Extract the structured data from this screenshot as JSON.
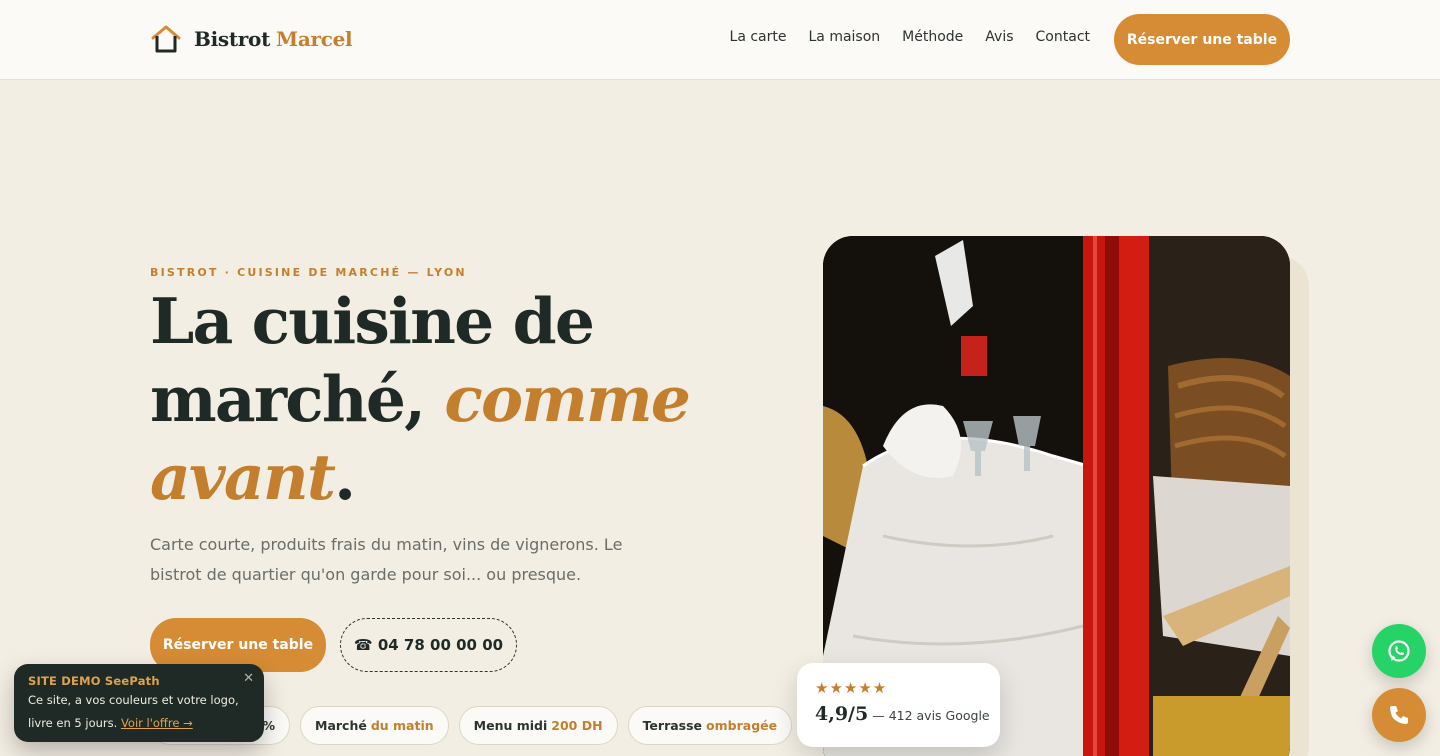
{
  "header": {
    "brand_first": "Bistrot",
    "brand_second": "Marcel",
    "logo_icon": "house-icon",
    "nav": [
      {
        "label": "La carte"
      },
      {
        "label": "La maison"
      },
      {
        "label": "Méthode"
      },
      {
        "label": "Avis"
      },
      {
        "label": "Contact"
      }
    ],
    "cta_label": "Réserver une table"
  },
  "hero": {
    "eyebrow": "BISTROT · CUISINE DE MARCHÉ — LYON",
    "title_line1": "La cuisine de",
    "title_line2": "marché, ",
    "title_accent1": "comme",
    "title_accent2": "avant",
    "title_end": ".",
    "subtitle": "Carte courte, produits frais du matin, vins de vignerons. Le bistrot de quartier qu'on garde pour soi... ou presque.",
    "cta_label": "Réserver une table",
    "phone_label": "☎ 04 78 00 00 00",
    "pills": [
      {
        "text": "%",
        "highlight": ""
      },
      {
        "text": "Marché",
        "highlight": "du matin"
      },
      {
        "text": "Menu midi",
        "highlight": "200 DH"
      },
      {
        "text": "Terrasse",
        "highlight": "ombragée"
      }
    ]
  },
  "rating": {
    "stars": "★★★★★",
    "score": "4,9/5",
    "reviews": "— 412 avis Google"
  },
  "toast": {
    "title": "SITE DEMO SeePath",
    "body": "Ce site, a vos couleurs et votre logo, livre en 5 jours.",
    "link": "Voir l'offre →",
    "close": "✕"
  },
  "fabs": {
    "whatsapp_icon": "whatsapp-icon",
    "phone_icon": "phone-icon"
  },
  "colors": {
    "accent": "#d68c35",
    "accent_text": "#c47f2e",
    "dark": "#1f2a26",
    "background": "#f3eee4",
    "whatsapp": "#25d366"
  }
}
